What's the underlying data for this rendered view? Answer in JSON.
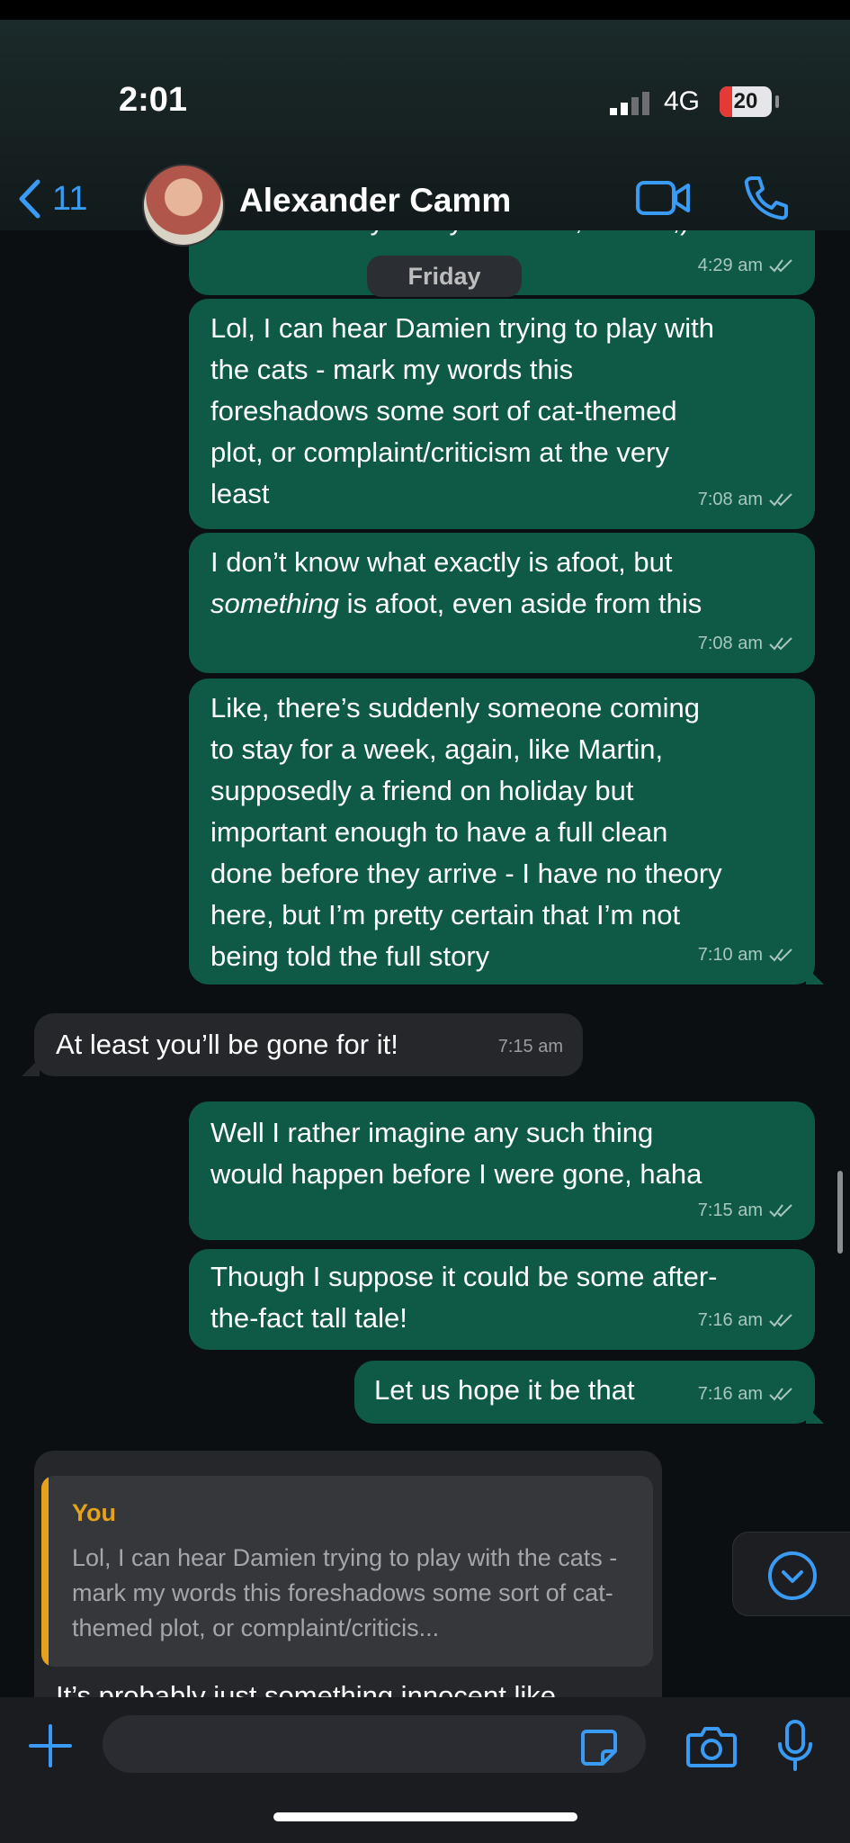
{
  "status": {
    "time": "2:01",
    "network": "4G",
    "battery": "20"
  },
  "header": {
    "back_count": "11",
    "contact_name": "Alexander Camm"
  },
  "chat": {
    "date_divider": "Friday",
    "prev_fragment": "car when they finally launch it, etc etc,)",
    "prev_time": "4:29 am",
    "messages": [
      {
        "dir": "out",
        "lines": [
          "Lol, I can hear Damien trying to play with",
          "the cats - mark my words this",
          "foreshadows some sort of cat-themed",
          "plot, or complaint/criticism at the very",
          "least"
        ],
        "time": "7:08 am"
      },
      {
        "dir": "out",
        "lines": [
          "I don’t know what exactly is afoot, but",
          "something is afoot, even aside from this"
        ],
        "emphasis": "something",
        "time": "7:08 am"
      },
      {
        "dir": "out",
        "lines": [
          "Like, there’s suddenly someone coming",
          "to stay for a week, again, like Martin,",
          "supposedly a friend on holiday but",
          "important enough to have a full clean",
          "done before they arrive - I have no theory",
          "here, but I’m pretty certain that I’m not",
          "being told the full story"
        ],
        "time": "7:10 am"
      },
      {
        "dir": "in",
        "lines": [
          "At least you’ll be gone for it!"
        ],
        "time": "7:15 am"
      },
      {
        "dir": "out",
        "lines": [
          "Well I rather imagine any such thing",
          "would happen before I were gone, haha"
        ],
        "time": "7:15 am"
      },
      {
        "dir": "out",
        "lines": [
          "Though I suppose it could be some after-",
          "the-fact tall tale!"
        ],
        "time": "7:16 am"
      },
      {
        "dir": "out",
        "lines": [
          "Let us hope it be that"
        ],
        "time": "7:16 am"
      }
    ],
    "reply": {
      "quote_author": "You",
      "quote_text": "Lol, I can hear Damien trying to play with the cats - mark my words this foreshadows some sort of cat-themed plot, or complaint/criticis...",
      "text": "It’s probably just something innocent like"
    }
  },
  "composer": {
    "placeholder": ""
  },
  "icons": {
    "back": "chevron-left-icon",
    "video": "video-call-icon",
    "call": "phone-icon",
    "down": "scroll-down-icon",
    "plus": "plus-icon",
    "sticker": "sticker-icon",
    "camera": "camera-icon",
    "mic": "microphone-icon"
  },
  "colors": {
    "outgoing": "#0e5a47",
    "incoming": "#25272b",
    "accent": "#3a9bf4",
    "quote": "#e5a21a"
  }
}
